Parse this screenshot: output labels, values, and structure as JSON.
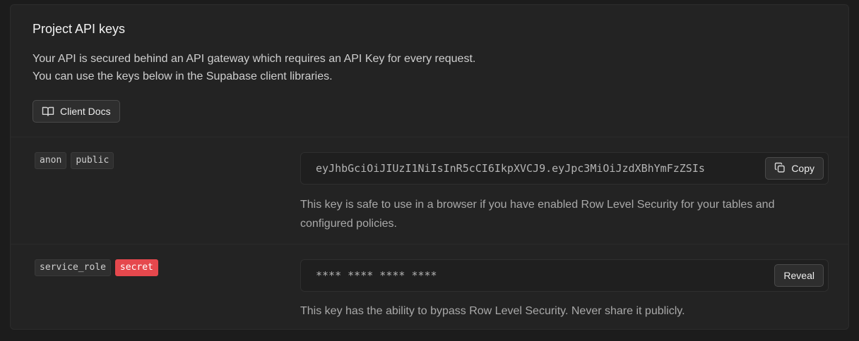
{
  "section": {
    "title": "Project API keys",
    "description_line1": "Your API is secured behind an API gateway which requires an API Key for every request.",
    "description_line2": "You can use the keys below in the Supabase client libraries.",
    "docs_button_label": "Client Docs",
    "docs_button_icon": "book-icon"
  },
  "keys": [
    {
      "tags": [
        "anon",
        "public"
      ],
      "value": "eyJhbGciOiJIUzI1NiIsInR5cCI6IkpXVCJ9.eyJpc3MiOiJzdXBhYmFzZSIs",
      "action_label": "Copy",
      "action_icon": "copy-icon",
      "note_line1": "This key is safe to use in a browser if you have enabled Row Level Security for your tables and",
      "note_line2": "configured policies."
    },
    {
      "tags": [
        "service_role",
        "secret"
      ],
      "value": "**** **** **** ****",
      "action_label": "Reveal",
      "note_line1": "This key has the ability to bypass Row Level Security. Never share it publicly."
    }
  ],
  "colors": {
    "background": "#1c1c1c",
    "panel": "#232323",
    "danger_tag": "#e5484d"
  }
}
